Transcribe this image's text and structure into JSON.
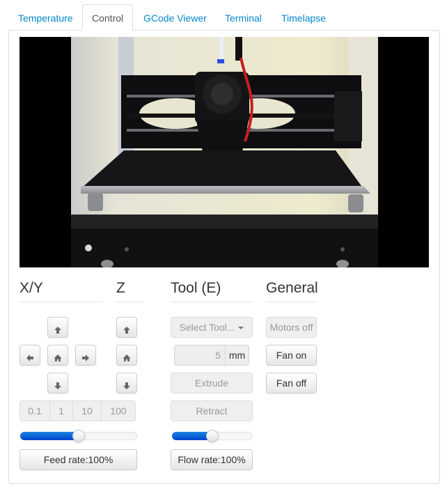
{
  "tabs": [
    {
      "label": "Temperature",
      "active": false
    },
    {
      "label": "Control",
      "active": true
    },
    {
      "label": "GCode Viewer",
      "active": false
    },
    {
      "label": "Terminal",
      "active": false
    },
    {
      "label": "Timelapse",
      "active": false
    }
  ],
  "webcam": {
    "description": "Live webcam stream of 3D printer hotend over print bed"
  },
  "xy": {
    "heading": "X/Y",
    "buttons": {
      "up": "arrow-up-icon",
      "left": "arrow-left-icon",
      "home": "home-icon",
      "right": "arrow-right-icon",
      "down": "arrow-down-icon"
    },
    "step_sizes": [
      "0.1",
      "1",
      "10",
      "100"
    ],
    "feed_rate_percent": 100,
    "feed_rate_slider_fraction": 0.5,
    "feed_rate_label": "Feed rate:100%"
  },
  "z": {
    "heading": "Z",
    "buttons": {
      "up": "arrow-up-icon",
      "home": "home-icon",
      "down": "arrow-down-icon"
    }
  },
  "tool": {
    "heading": "Tool (E)",
    "select_label": "Select Tool...",
    "amount_value": "5",
    "amount_unit": "mm",
    "extrude_label": "Extrude",
    "retract_label": "Retract",
    "flow_rate_percent": 100,
    "flow_rate_slider_fraction": 0.5,
    "flow_rate_label": "Flow rate:100%"
  },
  "general": {
    "heading": "General",
    "motors_off_label": "Motors off",
    "fan_on_label": "Fan on",
    "fan_off_label": "Fan off"
  },
  "colors": {
    "link": "#0088cc",
    "slider_fill": "#0044cc"
  }
}
